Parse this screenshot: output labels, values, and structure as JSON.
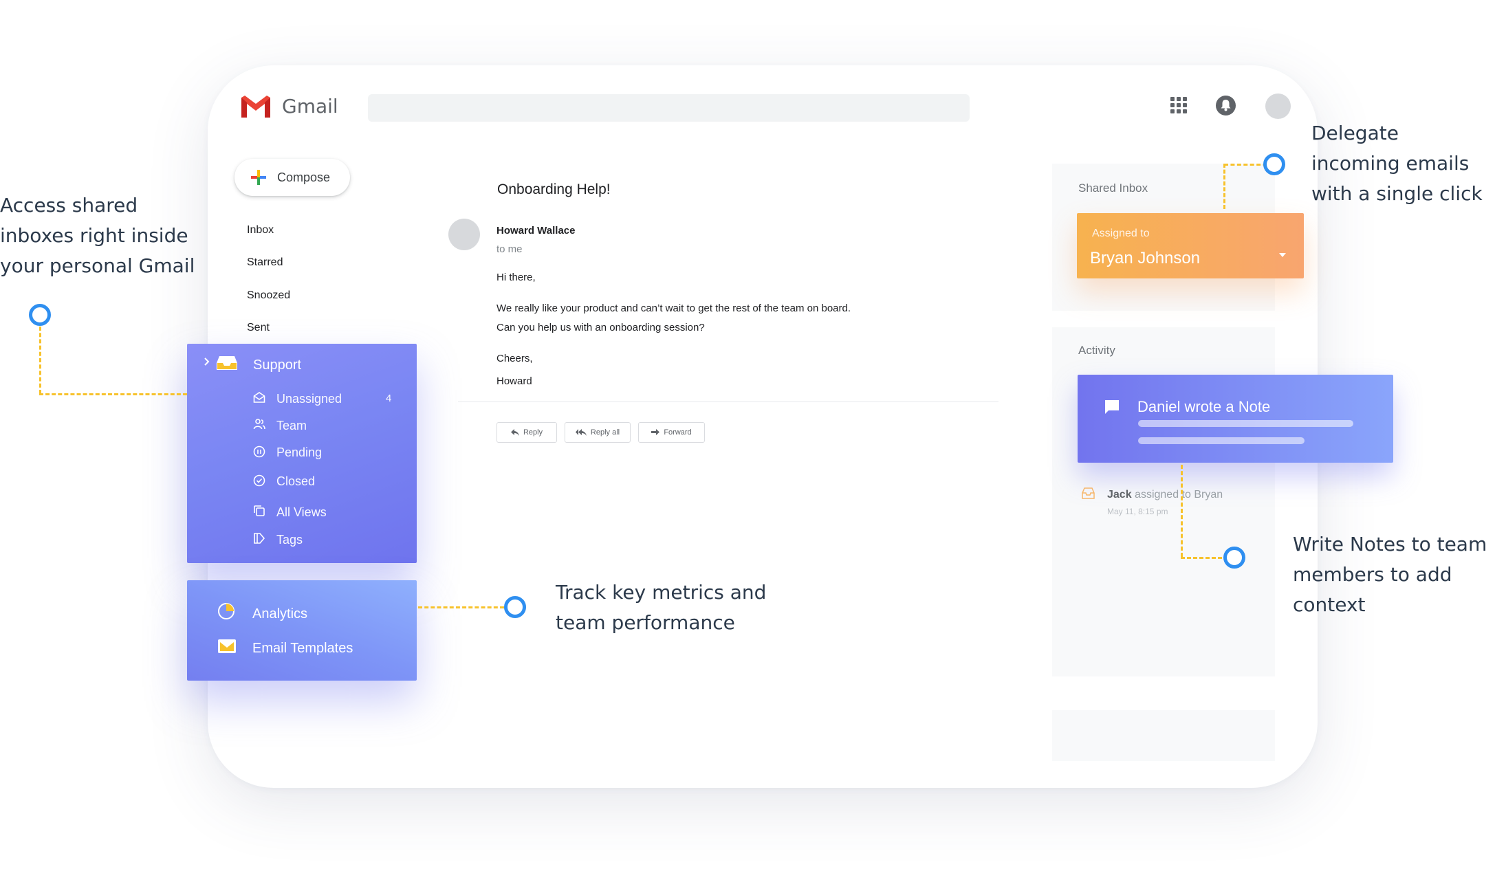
{
  "header": {
    "app_name": "Gmail",
    "search_placeholder": "",
    "icons": [
      "gmail-logo",
      "apps-grid-icon",
      "notifications-bell-icon",
      "account-avatar"
    ]
  },
  "sidebar": {
    "compose_label": "Compose",
    "nav": [
      "Inbox",
      "Starred",
      "Snoozed",
      "Sent"
    ]
  },
  "support_panel": {
    "title": "Support",
    "items": [
      {
        "label": "Unassigned",
        "count": "4",
        "icon": "envelope-open-icon"
      },
      {
        "label": "Team",
        "icon": "people-icon"
      },
      {
        "label": "Pending",
        "icon": "pause-circle-icon"
      },
      {
        "label": "Closed",
        "icon": "check-circle-icon"
      },
      {
        "label": "All Views",
        "icon": "copy-icon"
      },
      {
        "label": "Tags",
        "icon": "tag-icon"
      }
    ]
  },
  "extra_panel": {
    "items": [
      {
        "label": "Analytics",
        "icon": "pie-chart-icon"
      },
      {
        "label": "Email Templates",
        "icon": "template-envelope-icon"
      }
    ]
  },
  "email": {
    "subject": "Onboarding Help!",
    "sender": "Howard Wallace",
    "recipient": "to me",
    "body": [
      "Hi there,",
      "We really like your product and can’t wait to get the rest of the team on board.",
      "Can you help us with an onboarding session?",
      "Cheers,",
      "Howard"
    ],
    "actions": [
      "Reply",
      "Reply all",
      "Forward"
    ]
  },
  "right_panel": {
    "shared_inbox_label": "Shared Inbox",
    "assigned_label": "Assigned to",
    "assignee": "Bryan Johnson",
    "activity_label": "Activity",
    "note_title": "Daniel wrote a Note",
    "log": {
      "actor": "Jack",
      "action": "assigned to Bryan",
      "time": "May 11, 8:15 pm"
    }
  },
  "callouts": {
    "left": [
      "Access shared",
      "inboxes right inside",
      "your personal Gmail"
    ],
    "top_right": [
      "Delegate",
      "incoming emails",
      "with a single click"
    ],
    "middle": [
      "Track key metrics and",
      "team performance"
    ],
    "bottom_right": [
      "Write Notes to team",
      "members to add context"
    ]
  },
  "colors": {
    "accent_blue": "#2f8ff0",
    "connector_yellow": "#f7c22c",
    "panel_purple": "#7a86f3",
    "assigned_orange": "#f8a56f"
  }
}
